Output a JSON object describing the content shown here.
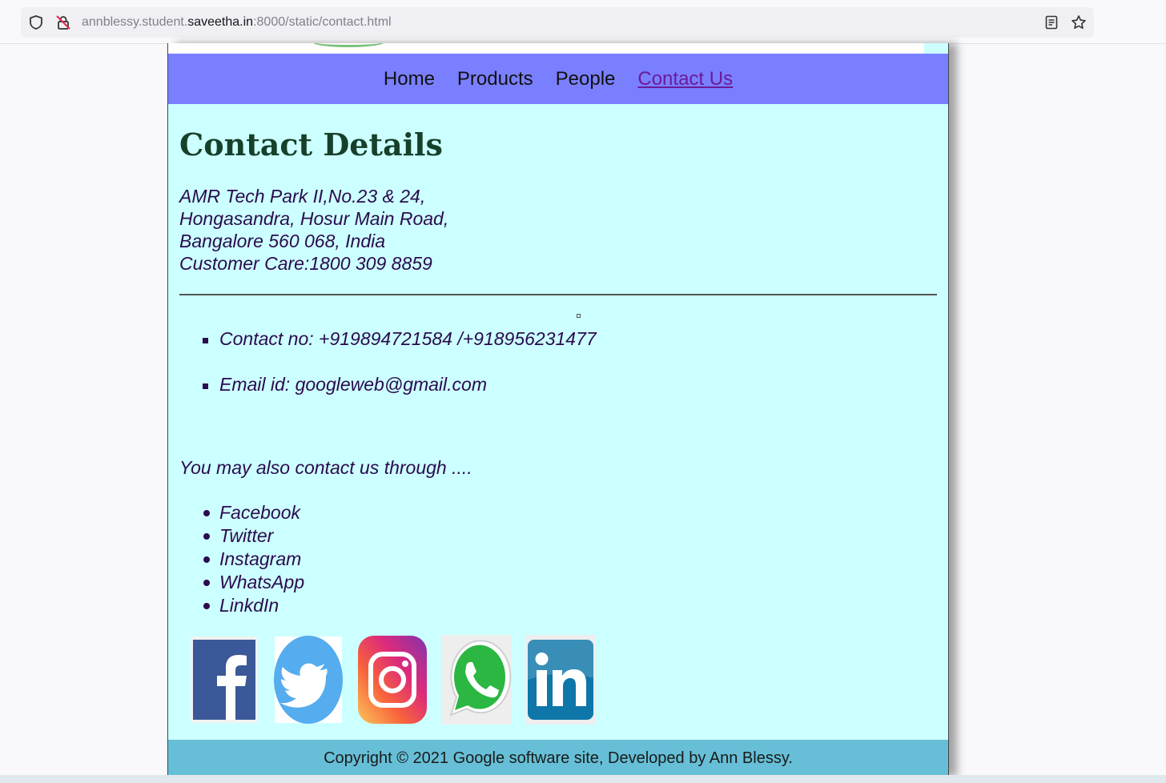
{
  "browser": {
    "url_prefix": "annblessy.student.",
    "url_host": "saveetha.in",
    "url_suffix": ":8000/static/contact.html"
  },
  "nav": {
    "items": [
      {
        "label": "Home"
      },
      {
        "label": "Products"
      },
      {
        "label": "People"
      },
      {
        "label": "Contact Us"
      }
    ]
  },
  "main": {
    "title": "Contact Details",
    "address": [
      "AMR Tech Park II,No.23 & 24,",
      "Hongasandra, Hosur Main Road,",
      "Bangalore 560 068, India",
      "Customer Care:1800 309 8859"
    ],
    "contacts": [
      "Contact no: +919894721584 /+918956231477",
      "Email id: googleweb@gmail.com"
    ],
    "also_text": "You may also contact us through ....",
    "social": [
      "Facebook",
      "Twitter",
      "Instagram",
      "WhatsApp",
      "LinkdIn"
    ]
  },
  "footer": {
    "text": "Copyright © 2021 Google software site, Developed by Ann Blessy."
  },
  "colors": {
    "nav_bg": "#7a7fff",
    "page_bg": "#ccffff",
    "footer_bg": "#66bfd6",
    "text": "#2a0b4e",
    "title": "#17402a",
    "active_link": "#6a1b9a"
  }
}
